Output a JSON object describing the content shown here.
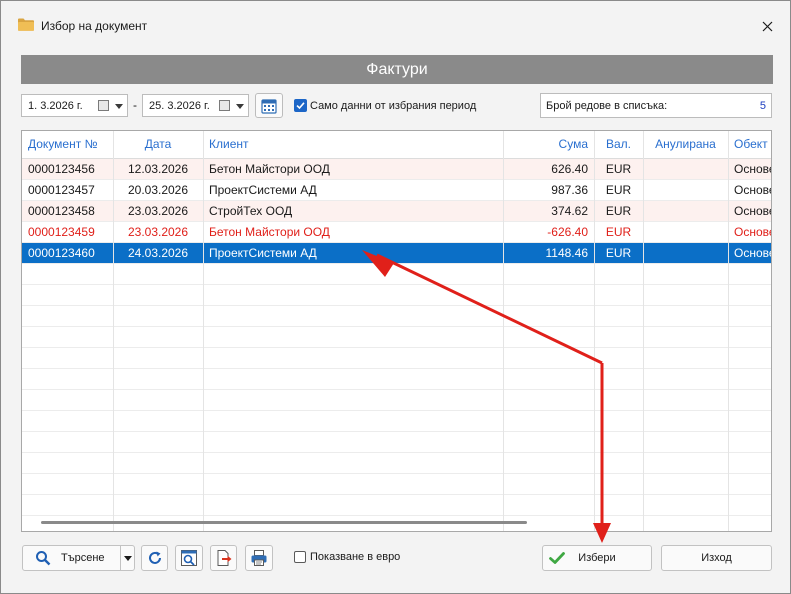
{
  "window": {
    "title": "Избор на документ",
    "close_glyph": "✕"
  },
  "banner": {
    "title": "Фактури"
  },
  "filter": {
    "date_from": "1.  3.2026 г.",
    "date_to": "25.  3.2026 г.",
    "separator": "-",
    "only_period_label": "Само данни от избрания период",
    "only_period_checked": true,
    "rows_count_label": "Брой редове в списъка:",
    "rows_count_value": "5"
  },
  "table": {
    "columns": [
      "Документ №",
      "Дата",
      "Клиент",
      "Сума",
      "Вал.",
      "Анулирана",
      "Обект"
    ],
    "rows": [
      {
        "doc": "0000123456",
        "date": "12.03.2026",
        "client": "Бетон Майстори ООД",
        "amount": "626.40",
        "currency": "EUR",
        "cancelled": "",
        "object": "Основе",
        "state": "normal"
      },
      {
        "doc": "0000123457",
        "date": "20.03.2026",
        "client": "ПроектСистеми АД",
        "amount": "987.36",
        "currency": "EUR",
        "cancelled": "",
        "object": "Основе",
        "state": "normal"
      },
      {
        "doc": "0000123458",
        "date": "23.03.2026",
        "client": "СтройТех ООД",
        "amount": "374.62",
        "currency": "EUR",
        "cancelled": "",
        "object": "Основе",
        "state": "normal"
      },
      {
        "doc": "0000123459",
        "date": "23.03.2026",
        "client": "Бетон Майстори ООД",
        "amount": "-626.40",
        "currency": "EUR",
        "cancelled": "",
        "object": "Основе",
        "state": "negative"
      },
      {
        "doc": "0000123460",
        "date": "24.03.2026",
        "client": "ПроектСистеми АД",
        "amount": "1148.46",
        "currency": "EUR",
        "cancelled": "",
        "object": "Основе",
        "state": "selected"
      }
    ]
  },
  "footer": {
    "search_label": "Търсене",
    "euro_label": "Показване в евро",
    "euro_checked": false,
    "select_label": "Избери",
    "exit_label": "Изход"
  },
  "colors": {
    "header_text": "#2a6fcf",
    "selected_bg": "#0b6fc7",
    "negative_text": "#e0201a",
    "row_alt_bg": "#fdf1ef",
    "arrow": "#e0201a"
  },
  "icons": [
    "folder-icon",
    "close-icon",
    "calendar-icon",
    "search-icon",
    "refresh-icon",
    "preview-icon",
    "export-icon",
    "print-icon",
    "checkmark-icon"
  ]
}
